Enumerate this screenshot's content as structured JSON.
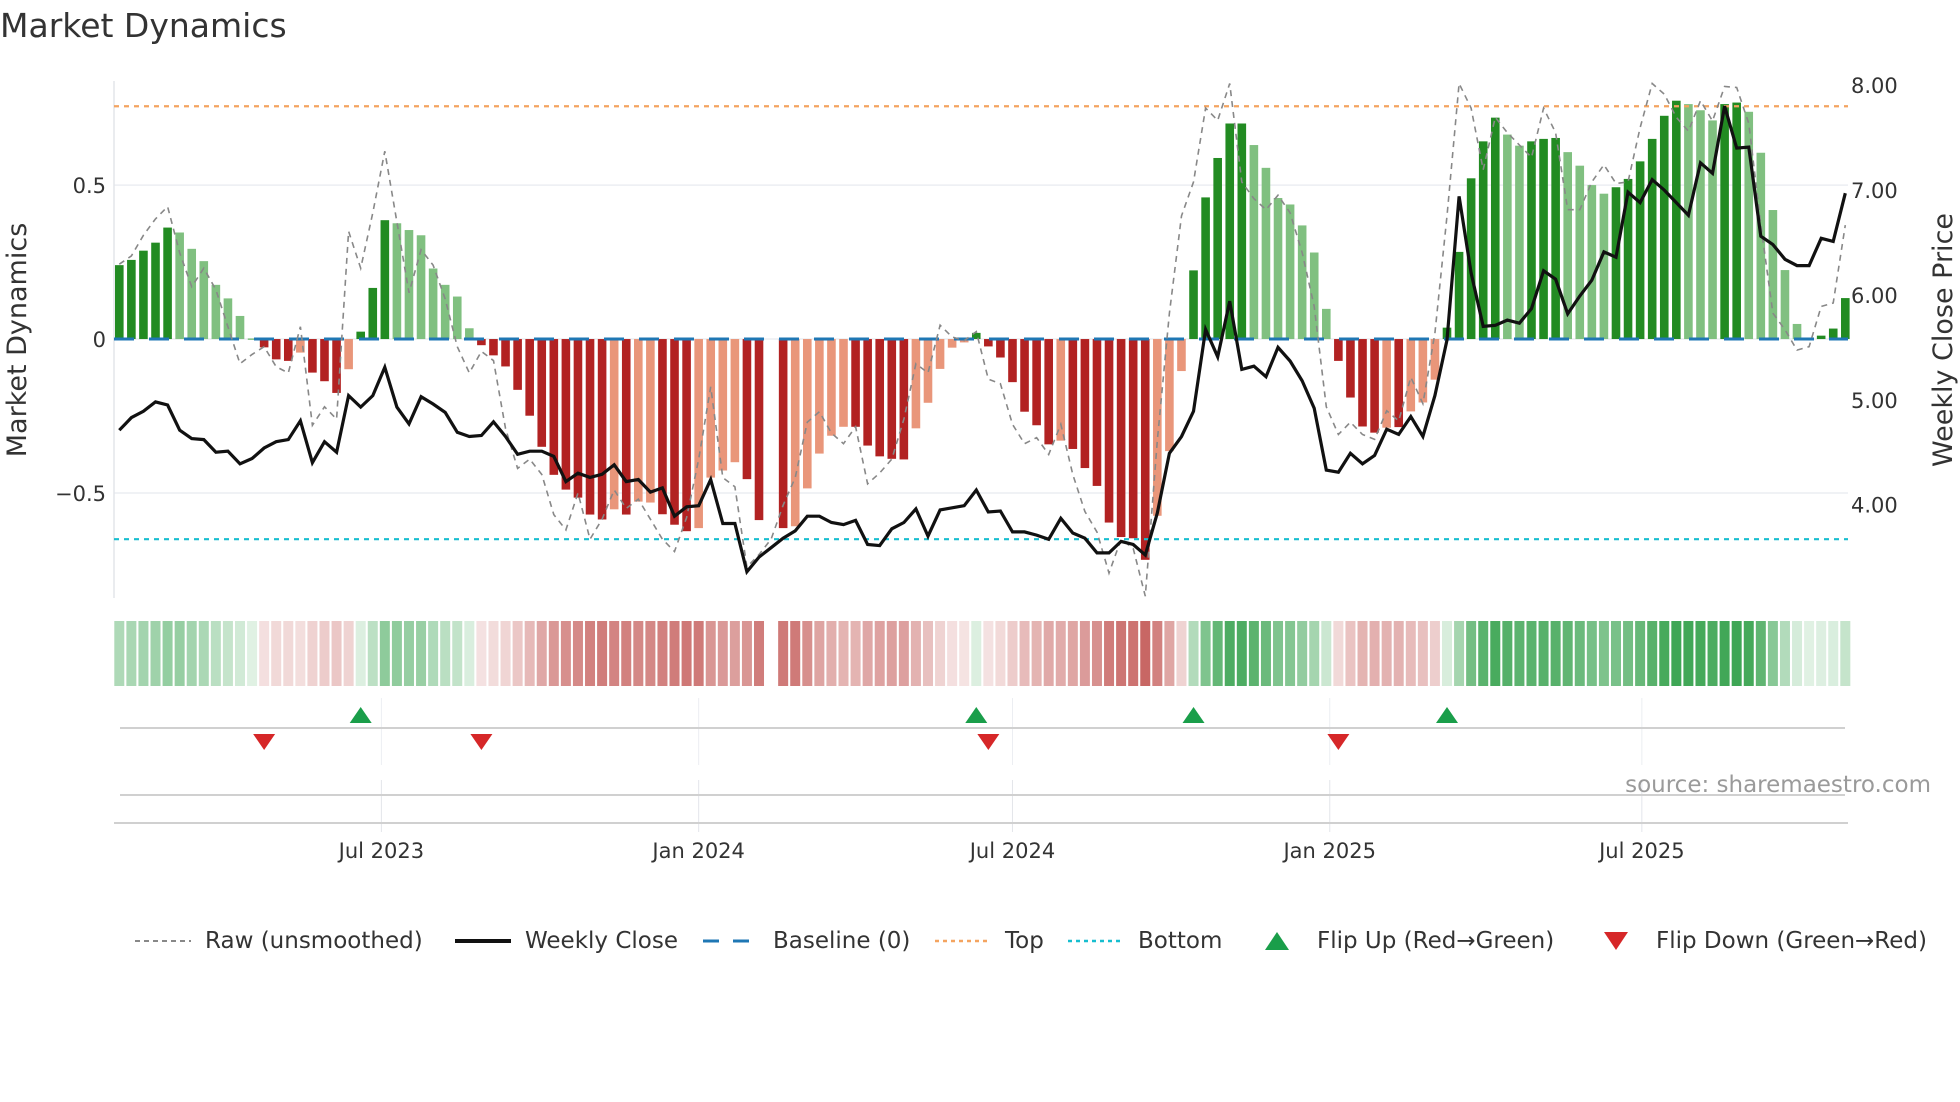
{
  "title": "Market Dynamics",
  "source": "source: sharemaestro.com",
  "legend": [
    {
      "label": "Raw (unsmoothed)",
      "icon": "dashed-line",
      "color": "#888888"
    },
    {
      "label": "Weekly Close",
      "icon": "solid-line",
      "color": "#111111"
    },
    {
      "label": "Baseline (0)",
      "icon": "dashed-line",
      "color": "#1f77b4"
    },
    {
      "label": "Top",
      "icon": "dotted-line",
      "color": "#f4a460"
    },
    {
      "label": "Bottom",
      "icon": "dotted-line",
      "color": "#17becf"
    },
    {
      "label": "Flip Up (Red→Green)",
      "icon": "triangle-up",
      "color": "#1a9e4a"
    },
    {
      "label": "Flip Down (Green→Red)",
      "icon": "triangle-down",
      "color": "#d62728"
    }
  ],
  "chart_data": {
    "type": "bar",
    "title": "Market Dynamics",
    "ylabel": "Market Dynamics",
    "ylabel_right": "Weekly Close Price",
    "xlabel": "",
    "start_date": "2023-01-30",
    "frequency": "weekly",
    "ylim_left": [
      -0.841,
      0.838
    ],
    "ylim_right": [
      3.11,
      8.04
    ],
    "yticks_left": [
      {
        "v": 0.5,
        "label": "0.5"
      },
      {
        "v": 0,
        "label": "0"
      },
      {
        "v": -0.5,
        "label": "−0.5"
      }
    ],
    "yticks_right": [
      {
        "v": 8,
        "label": "8.00"
      },
      {
        "v": 7,
        "label": "7.00"
      },
      {
        "v": 6,
        "label": "6.00"
      },
      {
        "v": 5,
        "label": "5.00"
      },
      {
        "v": 4,
        "label": "4.00"
      }
    ],
    "xticks": [
      {
        "label": "Jul 2023",
        "date": "2023-07-01"
      },
      {
        "label": "Jan 2024",
        "date": "2024-01-01"
      },
      {
        "label": "Jul 2024",
        "date": "2024-07-01"
      },
      {
        "label": "Jan 2025",
        "date": "2025-01-01"
      },
      {
        "label": "Jul 2025",
        "date": "2025-07-01"
      }
    ],
    "top_level": 0.756,
    "bottom_level": -0.65,
    "baseline": 0,
    "colors": {
      "G": "#228b22",
      "g": "#80c080",
      "R": "#b22222",
      "r": "#e9967a",
      "heat_pos": "#2e9e46",
      "heat_neg": "#c0504d",
      "baseline": "#1f77b4",
      "top": "#f4a460",
      "bottom": "#17becf",
      "close": "#111111",
      "raw": "#888888",
      "flip_up": "#1a9e4a",
      "flip_down": "#d62728"
    },
    "dynamics": [
      0.24,
      0.257,
      0.287,
      0.313,
      0.362,
      0.346,
      0.293,
      0.253,
      0.176,
      0.132,
      0.075,
      0.002,
      -0.027,
      -0.066,
      -0.071,
      -0.044,
      -0.109,
      -0.137,
      -0.175,
      -0.098,
      0.024,
      0.166,
      0.386,
      0.376,
      0.354,
      0.337,
      0.229,
      0.176,
      0.138,
      0.035,
      -0.02,
      -0.053,
      -0.089,
      -0.165,
      -0.249,
      -0.35,
      -0.441,
      -0.489,
      -0.515,
      -0.57,
      -0.586,
      -0.553,
      -0.57,
      -0.528,
      -0.531,
      -0.569,
      -0.603,
      -0.624,
      -0.614,
      -0.45,
      -0.427,
      -0.4,
      -0.455,
      -0.588,
      null,
      -0.614,
      -0.608,
      -0.485,
      -0.372,
      -0.314,
      -0.285,
      -0.285,
      -0.346,
      -0.381,
      -0.389,
      -0.391,
      -0.29,
      -0.207,
      -0.097,
      -0.028,
      -0.011,
      0.02,
      -0.024,
      -0.06,
      -0.14,
      -0.236,
      -0.28,
      -0.342,
      -0.33,
      -0.357,
      -0.419,
      -0.477,
      -0.596,
      -0.643,
      -0.647,
      -0.717,
      -0.574,
      -0.364,
      -0.104,
      0.223,
      0.46,
      0.588,
      0.7,
      0.7,
      0.63,
      0.556,
      0.458,
      0.437,
      0.369,
      0.281,
      0.098,
      -0.071,
      -0.19,
      -0.284,
      -0.304,
      -0.288,
      -0.286,
      -0.235,
      -0.206,
      -0.132,
      0.037,
      0.283,
      0.522,
      0.642,
      0.719,
      0.664,
      0.628,
      0.642,
      0.65,
      0.653,
      0.607,
      0.563,
      0.5,
      0.472,
      0.493,
      0.52,
      0.577,
      0.65,
      0.725,
      0.774,
      0.763,
      0.743,
      0.71,
      0.763,
      0.768,
      0.738,
      0.605,
      0.419,
      0.224,
      0.049,
      0.004,
      0.011,
      0.034,
      0.133
    ],
    "state": [
      "G",
      "G",
      "G",
      "G",
      "G",
      "g",
      "g",
      "g",
      "g",
      "g",
      "g",
      "g",
      "R",
      "R",
      "R",
      "r",
      "R",
      "R",
      "R",
      "r",
      "G",
      "G",
      "G",
      "g",
      "g",
      "g",
      "g",
      "g",
      "g",
      "g",
      "R",
      "R",
      "R",
      "R",
      "R",
      "R",
      "R",
      "R",
      "R",
      "R",
      "R",
      "r",
      "R",
      "r",
      "r",
      "R",
      "R",
      "R",
      "r",
      "r",
      "r",
      "r",
      "R",
      "R",
      null,
      "R",
      "r",
      "r",
      "r",
      "r",
      "r",
      "R",
      "R",
      "R",
      "R",
      "R",
      "r",
      "r",
      "r",
      "r",
      "r",
      "G",
      "R",
      "R",
      "R",
      "R",
      "R",
      "R",
      "r",
      "R",
      "R",
      "R",
      "R",
      "R",
      "R",
      "R",
      "r",
      "r",
      "r",
      "G",
      "G",
      "G",
      "G",
      "G",
      "g",
      "g",
      "g",
      "g",
      "g",
      "g",
      "g",
      "R",
      "R",
      "R",
      "R",
      "r",
      "R",
      "r",
      "r",
      "r",
      "G",
      "G",
      "G",
      "G",
      "G",
      "g",
      "g",
      "G",
      "G",
      "G",
      "g",
      "g",
      "g",
      "g",
      "G",
      "G",
      "G",
      "G",
      "G",
      "G",
      "g",
      "g",
      "g",
      "G",
      "G",
      "g",
      "g",
      "g",
      "g",
      "g",
      "g",
      "G",
      "G",
      "G"
    ],
    "close": [
      4.71,
      4.83,
      4.89,
      4.98,
      4.95,
      4.71,
      4.63,
      4.62,
      4.5,
      4.51,
      4.39,
      4.44,
      4.54,
      4.6,
      4.62,
      4.8,
      4.4,
      4.6,
      4.5,
      5.04,
      4.93,
      5.04,
      5.31,
      4.93,
      4.77,
      5.03,
      4.96,
      4.88,
      4.69,
      4.65,
      4.66,
      4.79,
      4.65,
      4.48,
      4.51,
      4.51,
      4.46,
      4.22,
      4.3,
      4.26,
      4.29,
      4.38,
      4.22,
      4.24,
      4.12,
      4.16,
      3.89,
      3.98,
      3.99,
      4.24,
      3.82,
      3.82,
      3.36,
      3.5,
      3.59,
      3.68,
      3.75,
      3.89,
      3.89,
      3.83,
      3.81,
      3.85,
      3.62,
      3.61,
      3.77,
      3.83,
      3.96,
      3.7,
      3.95,
      3.97,
      3.99,
      4.14,
      3.93,
      3.94,
      3.74,
      3.74,
      3.71,
      3.67,
      3.87,
      3.73,
      3.68,
      3.54,
      3.54,
      3.65,
      3.62,
      3.52,
      3.92,
      4.49,
      4.65,
      4.89,
      5.67,
      5.41,
      5.94,
      5.29,
      5.32,
      5.22,
      5.5,
      5.37,
      5.18,
      4.92,
      4.33,
      4.31,
      4.49,
      4.39,
      4.47,
      4.72,
      4.67,
      4.84,
      4.65,
      5.04,
      5.57,
      6.94,
      6.21,
      5.7,
      5.71,
      5.76,
      5.73,
      5.87,
      6.23,
      6.15,
      5.82,
      5.99,
      6.14,
      6.41,
      6.36,
      6.98,
      6.88,
      7.1,
      7.0,
      6.88,
      6.76,
      7.26,
      7.16,
      7.8,
      7.4,
      7.41,
      6.56,
      6.48,
      6.34,
      6.28,
      6.28,
      6.54,
      6.51,
      6.97
    ],
    "raw": [
      0.243,
      0.27,
      0.337,
      0.39,
      0.43,
      0.28,
      0.17,
      0.23,
      0.16,
      0.04,
      -0.08,
      -0.05,
      -0.025,
      -0.09,
      -0.11,
      0.04,
      -0.28,
      -0.22,
      -0.26,
      0.35,
      0.23,
      0.41,
      0.61,
      0.38,
      0.15,
      0.29,
      0.24,
      0.13,
      -0.025,
      -0.11,
      -0.04,
      -0.07,
      -0.29,
      -0.42,
      -0.39,
      -0.44,
      -0.57,
      -0.62,
      -0.5,
      -0.65,
      -0.585,
      -0.49,
      -0.55,
      -0.52,
      -0.585,
      -0.65,
      -0.69,
      -0.58,
      -0.39,
      -0.155,
      -0.45,
      -0.48,
      -0.74,
      -0.7,
      -0.65,
      -0.54,
      -0.45,
      -0.27,
      -0.236,
      -0.305,
      -0.34,
      -0.285,
      -0.47,
      -0.435,
      -0.39,
      -0.26,
      -0.08,
      -0.11,
      0.045,
      0.007,
      -0.005,
      0.024,
      -0.13,
      -0.145,
      -0.277,
      -0.34,
      -0.32,
      -0.375,
      -0.277,
      -0.44,
      -0.56,
      -0.627,
      -0.76,
      -0.65,
      -0.68,
      -0.835,
      -0.33,
      0.084,
      0.4,
      0.51,
      0.75,
      0.71,
      0.83,
      0.51,
      0.456,
      0.42,
      0.467,
      0.41,
      0.28,
      0.106,
      -0.22,
      -0.31,
      -0.27,
      -0.31,
      -0.326,
      -0.233,
      -0.266,
      -0.124,
      -0.21,
      0.019,
      0.4,
      0.83,
      0.75,
      0.55,
      0.72,
      0.67,
      0.63,
      0.59,
      0.75,
      0.67,
      0.42,
      0.42,
      0.51,
      0.566,
      0.505,
      0.51,
      0.686,
      0.83,
      0.795,
      0.72,
      0.675,
      0.774,
      0.708,
      0.82,
      0.817,
      0.7,
      0.37,
      0.084,
      0.03,
      -0.036,
      -0.025,
      0.106,
      0.117,
      0.37
    ],
    "flip_up_weeks": [
      21,
      72,
      90,
      111
    ],
    "flip_down_weeks": [
      13,
      31,
      73,
      102
    ],
    "grid": true,
    "legend_position": "bottom"
  }
}
